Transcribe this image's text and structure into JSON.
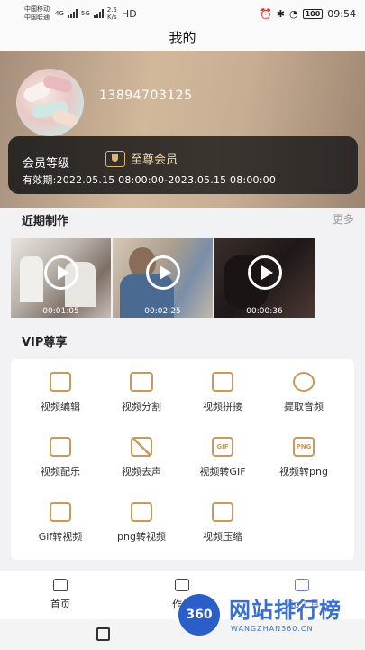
{
  "status_bar": {
    "carrier1": "中国移动",
    "carrier2": "中国联通",
    "net1": "4G",
    "net2": "5G",
    "speed_value": "2.5",
    "speed_unit": "K/s",
    "hd": "HD",
    "battery": "100",
    "time": "09:54"
  },
  "header": {
    "title": "我的"
  },
  "profile": {
    "phone": "13894703125"
  },
  "vip_card": {
    "level_label": "会员等级",
    "level_name": "至尊会员",
    "validity": "有效期:2022.05.15 08:00:00-2023.05.15 08:00:00"
  },
  "recent": {
    "title": "近期制作",
    "more": "更多",
    "videos": [
      {
        "duration": "00:01:05"
      },
      {
        "duration": "00:02:25"
      },
      {
        "duration": "00:00:36"
      }
    ]
  },
  "vip_tools": {
    "title": "VIP尊享",
    "items": [
      {
        "label": "视频编辑",
        "icon": "video-edit-icon"
      },
      {
        "label": "视频分割",
        "icon": "video-split-icon"
      },
      {
        "label": "视频拼接",
        "icon": "video-merge-icon"
      },
      {
        "label": "提取音频",
        "icon": "extract-audio-icon"
      },
      {
        "label": "视频配乐",
        "icon": "video-music-icon"
      },
      {
        "label": "视频去声",
        "icon": "mute-icon"
      },
      {
        "label": "视频转GIF",
        "icon": "gif-icon",
        "icon_text": "GIF"
      },
      {
        "label": "视频转png",
        "icon": "png-icon",
        "icon_text": "PNG"
      },
      {
        "label": "Gif转视频",
        "icon": "gif-to-video-icon"
      },
      {
        "label": "png转视频",
        "icon": "png-to-video-icon"
      },
      {
        "label": "视频压缩",
        "icon": "compress-icon"
      }
    ]
  },
  "tabbar": {
    "tabs": [
      {
        "label": "首页",
        "icon": "home-icon"
      },
      {
        "label": "作品",
        "icon": "works-icon"
      },
      {
        "label": "Vip工具",
        "icon": "vip-crown-icon"
      }
    ]
  },
  "watermark": {
    "logo_text": "360",
    "title": "网站排行榜",
    "subtitle": "WANGZHAN360.CN"
  },
  "colors": {
    "accent_gold": "#c59a5a",
    "vip_text": "#f0d9ae",
    "card_dark": "#2b2724",
    "watermark_blue": "#3a6fd0"
  }
}
